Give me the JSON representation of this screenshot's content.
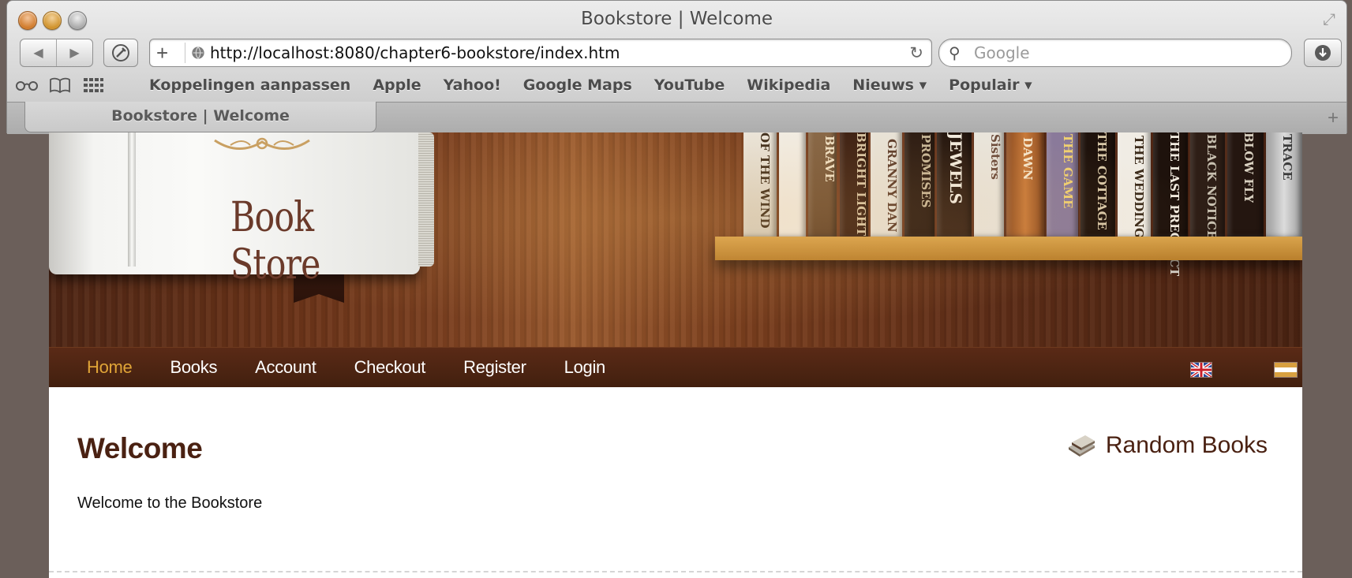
{
  "window": {
    "title": "Bookstore | Welcome"
  },
  "toolbar": {
    "url": "http://localhost:8080/chapter6-bookstore/index.htm",
    "search_placeholder": "Google"
  },
  "bookmarks": [
    {
      "label": "Koppelingen aanpassen"
    },
    {
      "label": "Apple"
    },
    {
      "label": "Yahoo!"
    },
    {
      "label": "Google Maps"
    },
    {
      "label": "YouTube"
    },
    {
      "label": "Wikipedia"
    },
    {
      "label": "Nieuws ▾"
    },
    {
      "label": "Populair ▾"
    }
  ],
  "tabs": [
    {
      "label": "Bookstore | Welcome"
    }
  ],
  "header": {
    "logo_text": "Book Store"
  },
  "nav": {
    "items": [
      {
        "label": "Home",
        "active": true
      },
      {
        "label": "Books"
      },
      {
        "label": "Account"
      },
      {
        "label": "Checkout"
      },
      {
        "label": "Register"
      },
      {
        "label": "Login"
      }
    ]
  },
  "content": {
    "title": "Welcome",
    "text": "Welcome to the Bookstore",
    "sidebar_title": "Random Books"
  },
  "colors": {
    "accent": "#e0a437",
    "heading": "#4a2112",
    "menu_bg": "#4f2513",
    "shelf": "#c58d38"
  }
}
